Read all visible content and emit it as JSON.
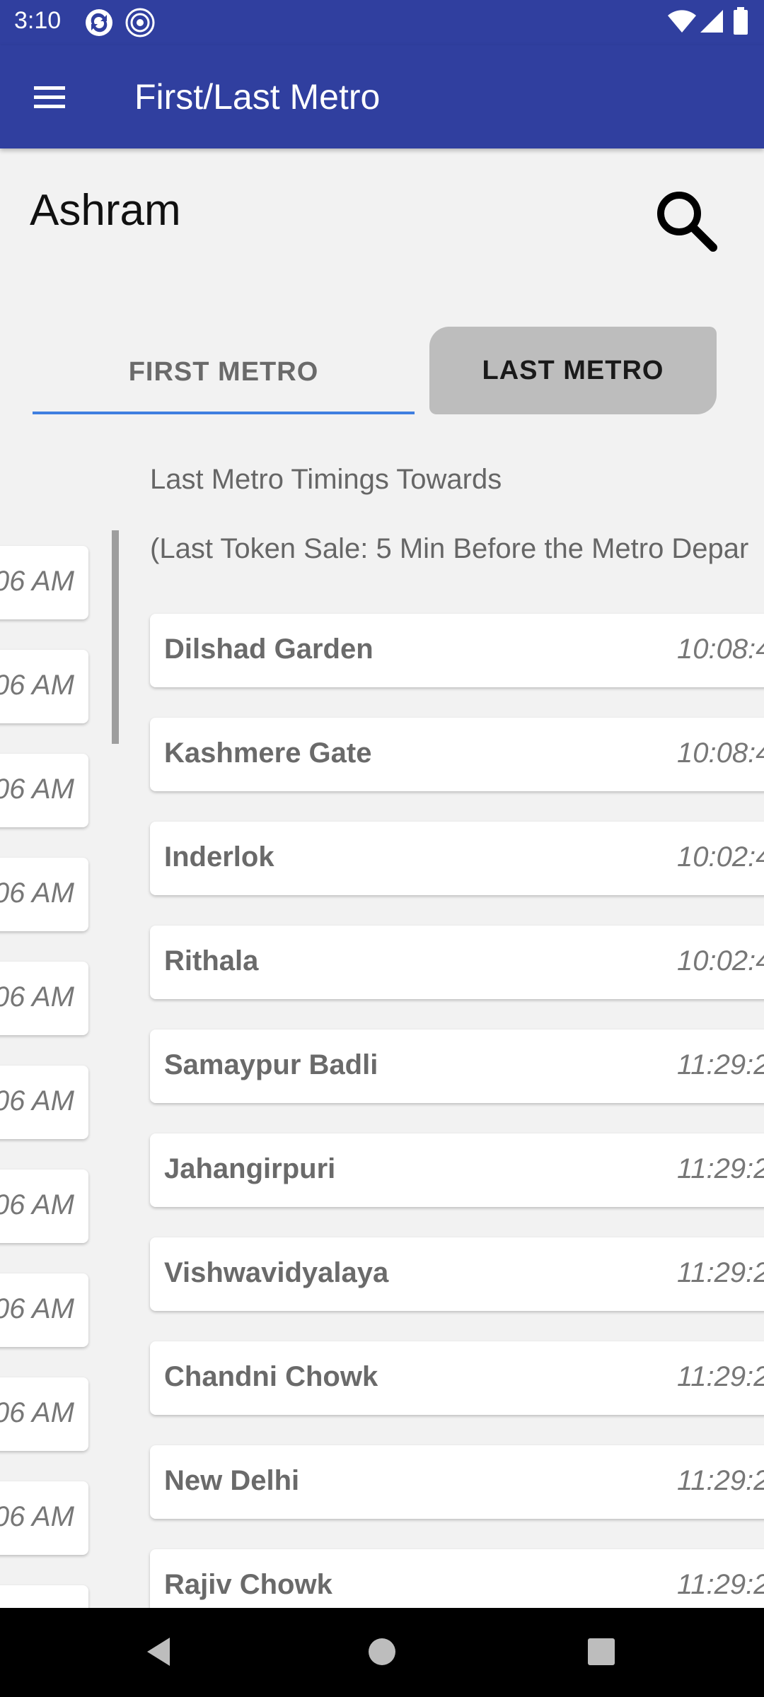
{
  "status_bar": {
    "time": "3:10"
  },
  "app_bar": {
    "title": "First/Last Metro"
  },
  "station": {
    "name": "Ashram"
  },
  "tabs": {
    "first": "FIRST METRO",
    "last": "LAST METRO",
    "selected": "last"
  },
  "first_metro_peek": {
    "times": [
      "06 AM",
      "06 AM",
      "06 AM",
      "06 AM",
      "06 AM",
      "06 AM",
      "06 AM",
      "06 AM",
      "06 AM",
      "06 AM"
    ]
  },
  "last_metro": {
    "heading": "Last Metro Timings Towards",
    "token_note": "(Last Token Sale: 5 Min Before the Metro Depar",
    "rows": [
      {
        "station": "Dilshad Garden",
        "time": "10:08:4"
      },
      {
        "station": "Kashmere Gate",
        "time": "10:08:4"
      },
      {
        "station": "Inderlok",
        "time": "10:02:4"
      },
      {
        "station": "Rithala",
        "time": "10:02:4"
      },
      {
        "station": "Samaypur Badli",
        "time": "11:29:2"
      },
      {
        "station": "Jahangirpuri",
        "time": "11:29:2"
      },
      {
        "station": "Vishwavidyalaya",
        "time": "11:29:2"
      },
      {
        "station": "Chandni Chowk",
        "time": "11:29:2"
      },
      {
        "station": "New Delhi",
        "time": "11:29:2"
      },
      {
        "station": "Rajiv Chowk",
        "time": "11:29:2"
      }
    ]
  },
  "colors": {
    "primary": "#303f9f",
    "tab_indicator": "#3f7fe0",
    "selected_tab_bg": "#bdbdbd",
    "background": "#f2f2f2"
  },
  "icons": {
    "menu": "hamburger-icon",
    "search": "search-icon",
    "back": "back-triangle-icon",
    "home": "home-circle-icon",
    "recents": "recents-square-icon"
  }
}
